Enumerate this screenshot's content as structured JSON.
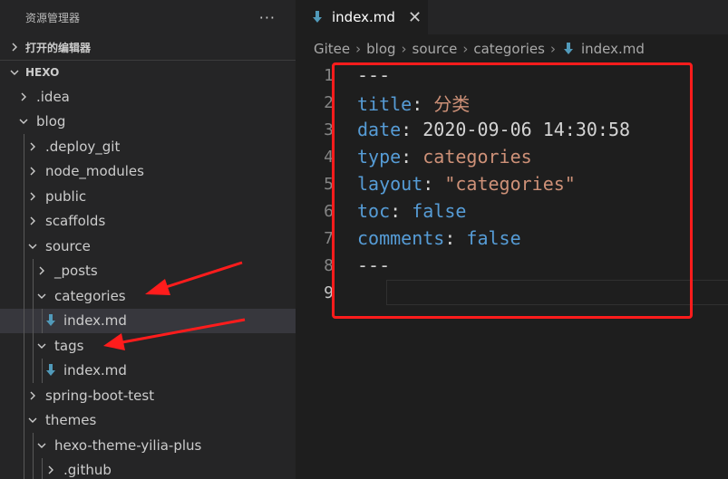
{
  "sidebar": {
    "title": "资源管理器",
    "more": "···",
    "open_editors": "打开的编辑器",
    "project": "HEXO",
    "tree": [
      {
        "label": ".idea",
        "type": "folder",
        "expanded": false
      },
      {
        "label": "blog",
        "type": "folder",
        "expanded": true
      },
      {
        "label": ".deploy_git",
        "type": "folder",
        "expanded": false
      },
      {
        "label": "node_modules",
        "type": "folder",
        "expanded": false
      },
      {
        "label": "public",
        "type": "folder",
        "expanded": false
      },
      {
        "label": "scaffolds",
        "type": "folder",
        "expanded": false
      },
      {
        "label": "source",
        "type": "folder",
        "expanded": true
      },
      {
        "label": "_posts",
        "type": "folder",
        "expanded": false
      },
      {
        "label": "categories",
        "type": "folder",
        "expanded": true
      },
      {
        "label": "index.md",
        "type": "file",
        "selected": true
      },
      {
        "label": "tags",
        "type": "folder",
        "expanded": true
      },
      {
        "label": "index.md",
        "type": "file"
      },
      {
        "label": "spring-boot-test",
        "type": "folder",
        "expanded": false
      },
      {
        "label": "themes",
        "type": "folder",
        "expanded": true
      },
      {
        "label": "hexo-theme-yilia-plus",
        "type": "folder",
        "expanded": true
      },
      {
        "label": ".github",
        "type": "folder",
        "expanded": false
      }
    ]
  },
  "editor": {
    "tab": {
      "label": "index.md",
      "close": "✕"
    },
    "breadcrumb": [
      "Gitee",
      "blog",
      "source",
      "categories",
      "index.md"
    ],
    "lines": [
      {
        "num": "1",
        "dash": "---"
      },
      {
        "num": "2",
        "key": "title",
        "colon": ": ",
        "value": "分类",
        "vtype": "string"
      },
      {
        "num": "3",
        "key": "date",
        "colon": ": ",
        "value": "2020-09-06 14:30:58",
        "vtype": "plain"
      },
      {
        "num": "4",
        "key": "type",
        "colon": ": ",
        "value": "categories",
        "vtype": "string"
      },
      {
        "num": "5",
        "key": "layout",
        "colon": ": ",
        "value": "\"categories\"",
        "vtype": "string"
      },
      {
        "num": "6",
        "key": "toc",
        "colon": ": ",
        "value": "false",
        "vtype": "bool"
      },
      {
        "num": "7",
        "key": "comments",
        "colon": ": ",
        "value": "false",
        "vtype": "bool"
      },
      {
        "num": "8",
        "dash": "---"
      },
      {
        "num": "9",
        "current": true
      }
    ]
  },
  "colors": {
    "annotation_red": "#ff1c1c",
    "md_icon": "#519aba",
    "yaml_key": "#569cd6",
    "yaml_string": "#ce9178"
  }
}
